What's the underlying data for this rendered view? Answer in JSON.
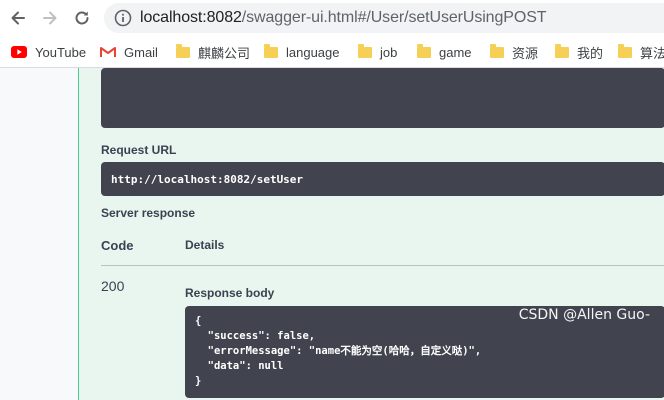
{
  "browser": {
    "url_host": "localhost:8082",
    "url_path": "/swagger-ui.html#/User/setUserUsingPOST",
    "bookmarks": [
      {
        "label": "YouTube",
        "icon": "youtube-icon"
      },
      {
        "label": "Gmail",
        "icon": "gmail-icon"
      },
      {
        "label": "麒麟公司",
        "icon": "folder-icon"
      },
      {
        "label": "language",
        "icon": "folder-icon"
      },
      {
        "label": "job",
        "icon": "folder-icon"
      },
      {
        "label": "game",
        "icon": "folder-icon"
      },
      {
        "label": "资源",
        "icon": "folder-icon"
      },
      {
        "label": "我的",
        "icon": "folder-icon"
      },
      {
        "label": "算法",
        "icon": "folder-icon"
      }
    ]
  },
  "swagger": {
    "request_url_label": "Request URL",
    "request_url": "http://localhost:8082/setUser",
    "server_response_label": "Server response",
    "code_header": "Code",
    "details_header": "Details",
    "status_code": "200",
    "response_body_label": "Response body",
    "response_body": "{\n  \"success\": false,\n  \"errorMessage\": \"name不能为空(哈哈，自定义哒)\",\n  \"data\": null\n}"
  },
  "watermark": "CSDN @Allen Guo-",
  "colors": {
    "panel_bg": "#e9f6f0",
    "panel_border": "#49cc90",
    "code_bg": "#41444e"
  }
}
